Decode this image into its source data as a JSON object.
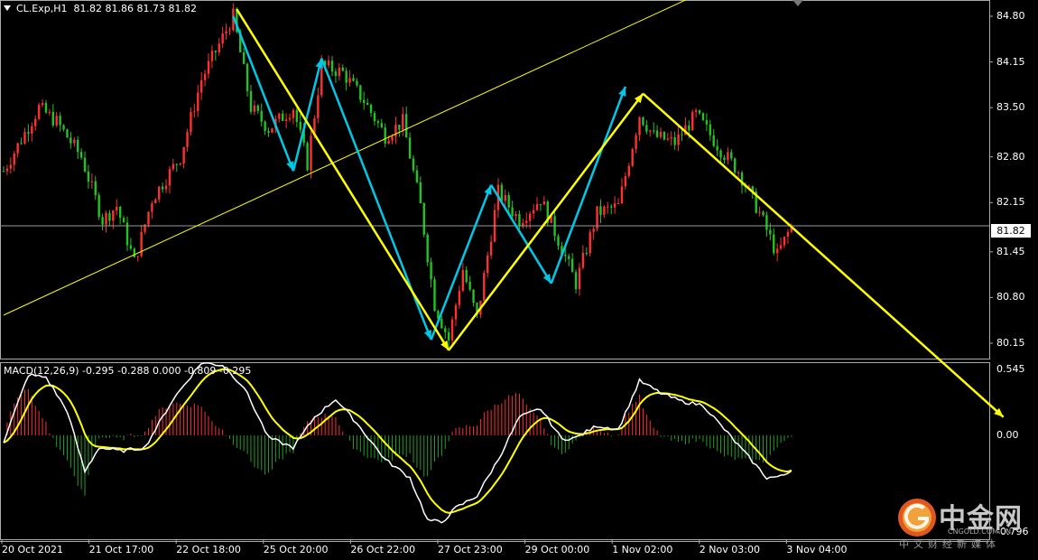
{
  "header": {
    "symbol": "CL.Exp,H1",
    "ohlc": "81.82 81.86 81.73 81.82"
  },
  "macd_header": "MACD(12,26,9) -0.295 -0.288 0.000 -0.809 -0.295",
  "last_price": "81.82",
  "watermark": {
    "title": "中金网",
    "domain": "CNGOLD.COM.CN",
    "tagline": "中文财经新媒体"
  },
  "colors": {
    "bull": "#ff3030",
    "bear": "#22c422",
    "trend": "#ffff00",
    "wave": "#00c8e6",
    "macd_line": "#ffffff",
    "signal_line": "#ffff00",
    "hist_pos": "#ff3030",
    "hist_neg": "#22a022"
  },
  "chart_data": [
    {
      "type": "candlestick",
      "title": "CL.Exp,H1",
      "y_ticks": [
        "84.80",
        "84.15",
        "83.50",
        "82.80",
        "82.15",
        "81.45",
        "80.80",
        "80.15"
      ],
      "x_ticks": [
        "20 Oct 2021",
        "21 Oct 17:00",
        "22 Oct 18:00",
        "25 Oct 20:00",
        "26 Oct 22:00",
        "27 Oct 23:00",
        "29 Oct 00:00",
        "1 Nov 02:00",
        "2 Nov 03:00",
        "3 Nov 04:00"
      ],
      "ylim": [
        79.9,
        85.0
      ],
      "last_price": 81.82,
      "path_anchors": [
        {
          "t": 0,
          "p": 82.6
        },
        {
          "t": 10,
          "p": 83.5
        },
        {
          "t": 15,
          "p": 83.3
        },
        {
          "t": 22,
          "p": 82.8
        },
        {
          "t": 28,
          "p": 81.9
        },
        {
          "t": 32,
          "p": 82.1
        },
        {
          "t": 37,
          "p": 81.3
        },
        {
          "t": 42,
          "p": 82.2
        },
        {
          "t": 50,
          "p": 82.8
        },
        {
          "t": 56,
          "p": 83.9
        },
        {
          "t": 65,
          "p": 84.8
        },
        {
          "t": 70,
          "p": 83.5
        },
        {
          "t": 75,
          "p": 83.2
        },
        {
          "t": 82,
          "p": 83.5
        },
        {
          "t": 86,
          "p": 82.7
        },
        {
          "t": 90,
          "p": 84.1
        },
        {
          "t": 96,
          "p": 84.0
        },
        {
          "t": 102,
          "p": 83.6
        },
        {
          "t": 108,
          "p": 83.1
        },
        {
          "t": 113,
          "p": 83.3
        },
        {
          "t": 118,
          "p": 82.1
        },
        {
          "t": 122,
          "p": 80.7
        },
        {
          "t": 126,
          "p": 80.2
        },
        {
          "t": 130,
          "p": 81.2
        },
        {
          "t": 134,
          "p": 80.5
        },
        {
          "t": 140,
          "p": 82.3
        },
        {
          "t": 146,
          "p": 81.9
        },
        {
          "t": 152,
          "p": 82.2
        },
        {
          "t": 158,
          "p": 81.5
        },
        {
          "t": 162,
          "p": 81.0
        },
        {
          "t": 168,
          "p": 82.0
        },
        {
          "t": 174,
          "p": 82.1
        },
        {
          "t": 180,
          "p": 83.4
        },
        {
          "t": 184,
          "p": 83.1
        },
        {
          "t": 190,
          "p": 83.0
        },
        {
          "t": 196,
          "p": 83.4
        },
        {
          "t": 203,
          "p": 82.9
        },
        {
          "t": 208,
          "p": 82.6
        },
        {
          "t": 214,
          "p": 82.0
        },
        {
          "t": 219,
          "p": 81.4
        },
        {
          "t": 223,
          "p": 81.82
        }
      ],
      "annotations": [
        {
          "kind": "trend-line",
          "color": "yellow",
          "points": [
            [
              0,
              80.55
            ],
            [
              196,
              85.1
            ]
          ]
        },
        {
          "kind": "wave",
          "color": "cyan",
          "points": [
            [
              65,
              84.8
            ],
            [
              82,
              82.6
            ],
            [
              90,
              84.2
            ],
            [
              121,
              80.2
            ],
            [
              138,
              82.4
            ],
            [
              155,
              81.0
            ],
            [
              176,
              83.8
            ]
          ]
        },
        {
          "kind": "arrow",
          "color": "yellow",
          "points": [
            [
              66,
              84.9
            ],
            [
              126,
              80.05
            ],
            [
              181,
              83.7
            ],
            [
              283,
              79.1
            ]
          ]
        }
      ]
    },
    {
      "type": "macd",
      "title": "MACD(12,26,9)",
      "params": [
        12,
        26,
        9
      ],
      "values": {
        "macd": -0.295,
        "signal": -0.288,
        "hist": 0.0
      },
      "y_ticks": [
        "0.545",
        "0.00",
        "-0.796"
      ],
      "ylim": [
        -0.86,
        0.58
      ],
      "zero_line": true,
      "macd_anchors": [
        {
          "t": 0,
          "v": -0.05
        },
        {
          "t": 7,
          "v": 0.5
        },
        {
          "t": 12,
          "v": 0.48
        },
        {
          "t": 18,
          "v": 0.2
        },
        {
          "t": 23,
          "v": -0.3
        },
        {
          "t": 27,
          "v": -0.1
        },
        {
          "t": 33,
          "v": -0.13
        },
        {
          "t": 40,
          "v": -0.1
        },
        {
          "t": 48,
          "v": 0.3
        },
        {
          "t": 56,
          "v": 0.6
        },
        {
          "t": 62,
          "v": 0.58
        },
        {
          "t": 68,
          "v": 0.4
        },
        {
          "t": 75,
          "v": -0.02
        },
        {
          "t": 82,
          "v": -0.1
        },
        {
          "t": 88,
          "v": 0.15
        },
        {
          "t": 94,
          "v": 0.3
        },
        {
          "t": 100,
          "v": 0.1
        },
        {
          "t": 108,
          "v": -0.2
        },
        {
          "t": 115,
          "v": -0.35
        },
        {
          "t": 120,
          "v": -0.7
        },
        {
          "t": 124,
          "v": -0.72
        },
        {
          "t": 128,
          "v": -0.6
        },
        {
          "t": 134,
          "v": -0.5
        },
        {
          "t": 140,
          "v": -0.2
        },
        {
          "t": 146,
          "v": 0.15
        },
        {
          "t": 152,
          "v": 0.22
        },
        {
          "t": 158,
          "v": -0.03
        },
        {
          "t": 162,
          "v": -0.02
        },
        {
          "t": 168,
          "v": 0.08
        },
        {
          "t": 174,
          "v": 0.05
        },
        {
          "t": 180,
          "v": 0.45
        },
        {
          "t": 186,
          "v": 0.35
        },
        {
          "t": 192,
          "v": 0.28
        },
        {
          "t": 198,
          "v": 0.25
        },
        {
          "t": 204,
          "v": 0.05
        },
        {
          "t": 210,
          "v": -0.15
        },
        {
          "t": 216,
          "v": -0.35
        },
        {
          "t": 220,
          "v": -0.34
        },
        {
          "t": 223,
          "v": -0.295
        }
      ]
    }
  ]
}
